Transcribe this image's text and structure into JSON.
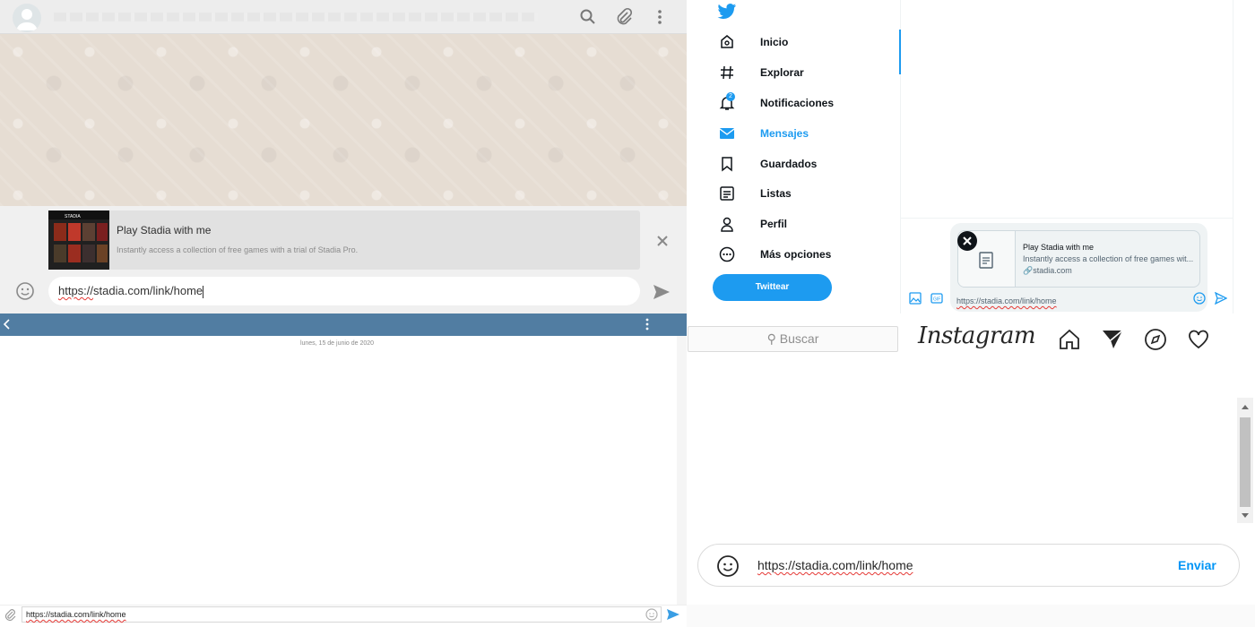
{
  "colors": {
    "twitter_blue": "#1d9bf0",
    "telegram_bar": "#517da2",
    "instagram_blue": "#0095f6",
    "whatsapp_bg": "#efeae2"
  },
  "whatsapp": {
    "header": {
      "icons": [
        "search-icon",
        "paperclip-icon",
        "more-vertical-icon"
      ]
    },
    "link_preview": {
      "title": "Play Stadia with me",
      "description": "Instantly access a collection of free games with a trial of Stadia Pro.",
      "thumb_text": "STADIA"
    },
    "input": {
      "url_prefix": "https://",
      "url_body": "stadia.com/link/home"
    }
  },
  "twitter": {
    "nav": [
      {
        "label": "Inicio",
        "icon": "home-icon"
      },
      {
        "label": "Explorar",
        "icon": "hashtag-icon"
      },
      {
        "label": "Notificaciones",
        "icon": "bell-icon",
        "badge": "2"
      },
      {
        "label": "Mensajes",
        "icon": "envelope-icon",
        "active": true
      },
      {
        "label": "Guardados",
        "icon": "bookmark-icon"
      },
      {
        "label": "Listas",
        "icon": "list-icon"
      },
      {
        "label": "Perfil",
        "icon": "person-icon"
      },
      {
        "label": "Más opciones",
        "icon": "more-circle-icon"
      }
    ],
    "tweet_button": "Twittear",
    "card": {
      "title": "Play Stadia with me",
      "description": "Instantly access a collection of free games wit...",
      "domain": "stadia.com"
    },
    "composer_text": "https://stadia.com/link/home"
  },
  "telegram": {
    "date": "lunes, 15 de junio de 2020",
    "input": "https://stadia.com/link/home"
  },
  "instagram": {
    "search_placeholder": "Buscar",
    "wordmark": "Instagram",
    "input": "https://stadia.com/link/home",
    "send_label": "Enviar"
  }
}
